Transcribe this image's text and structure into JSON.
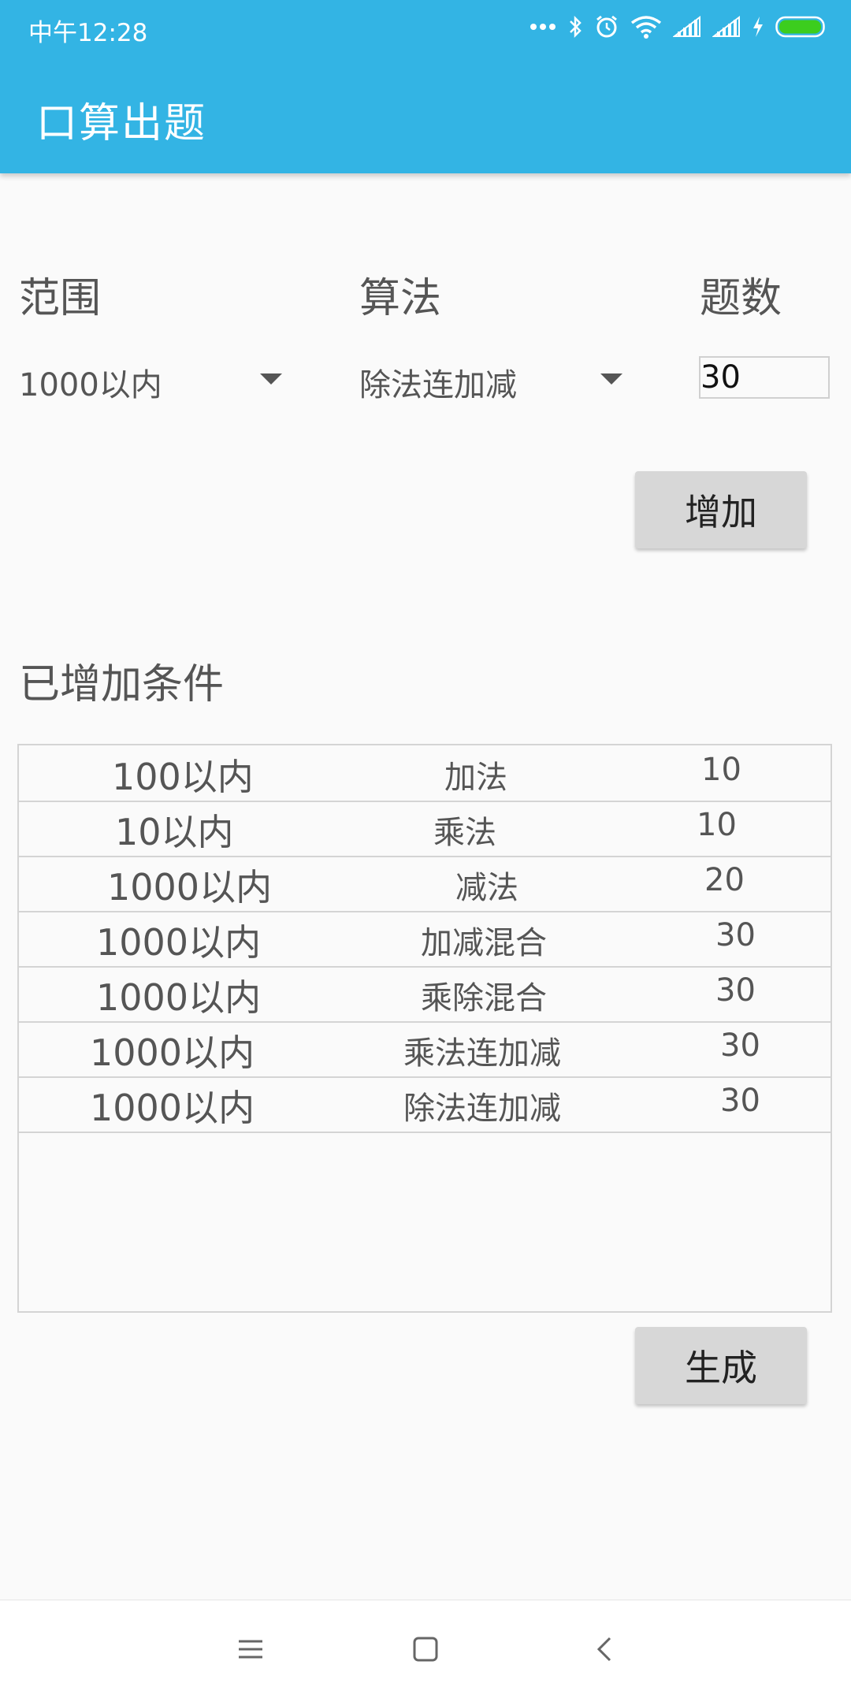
{
  "status_bar": {
    "time": "中午12:28",
    "icons": [
      "more-dots-icon",
      "bluetooth-icon",
      "alarm-icon",
      "wifi-icon",
      "signal-icon",
      "signal-icon",
      "charging-icon",
      "battery-icon"
    ],
    "battery_color": "#3ccd1e"
  },
  "app_bar": {
    "title": "口算出题",
    "color": "#33b4e4"
  },
  "form": {
    "range_label": "范围",
    "operation_label": "算法",
    "count_label": "题数",
    "range_value": "1000以内",
    "operation_value": "除法连加减",
    "count_value": "30",
    "add_button": "增加"
  },
  "added": {
    "title": "已增加条件",
    "rows": [
      {
        "range": "100以内",
        "operation": "加法",
        "count": "10"
      },
      {
        "range": "10以内",
        "operation": "乘法",
        "count": "10"
      },
      {
        "range": "1000以内",
        "operation": "减法",
        "count": "20"
      },
      {
        "range": "1000以内",
        "operation": "加减混合",
        "count": "30"
      },
      {
        "range": "1000以内",
        "operation": "乘除混合",
        "count": "30"
      },
      {
        "range": "1000以内",
        "operation": "乘法连加减",
        "count": "30"
      },
      {
        "range": "1000以内",
        "operation": "除法连加减",
        "count": "30"
      }
    ]
  },
  "generate_button": "生成",
  "nav_bar": {
    "icons": [
      "menu-icon",
      "home-icon",
      "back-icon"
    ]
  }
}
